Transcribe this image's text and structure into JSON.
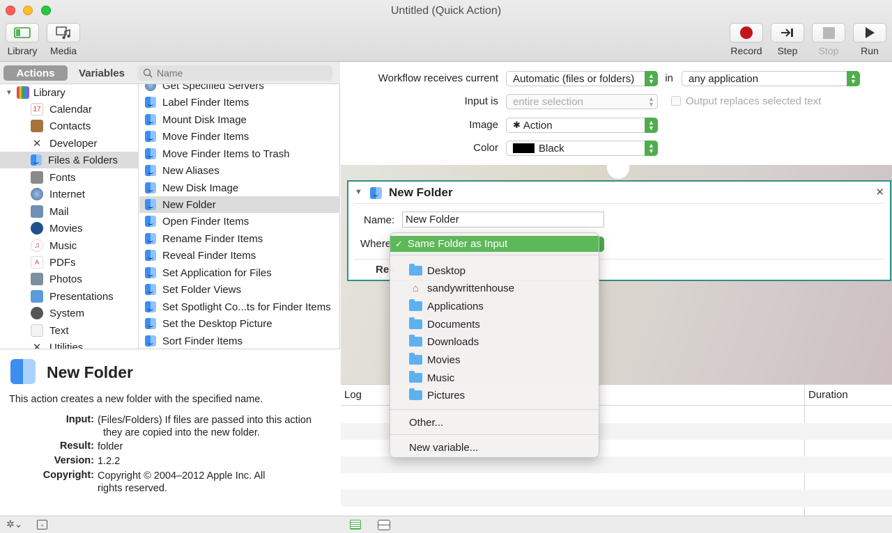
{
  "window": {
    "title": "Untitled (Quick Action)"
  },
  "toolbar": {
    "library": "Library",
    "media": "Media",
    "record": "Record",
    "step": "Step",
    "stop": "Stop",
    "run": "Run"
  },
  "tabs": {
    "actions": "Actions",
    "variables": "Variables"
  },
  "search": {
    "placeholder": "Name"
  },
  "library": {
    "root": "Library",
    "items": [
      {
        "label": "Calendar",
        "icon": "calendar-icon"
      },
      {
        "label": "Contacts",
        "icon": "contacts-icon"
      },
      {
        "label": "Developer",
        "icon": "developer-icon"
      },
      {
        "label": "Files & Folders",
        "icon": "finder-icon"
      },
      {
        "label": "Fonts",
        "icon": "fonts-icon"
      },
      {
        "label": "Internet",
        "icon": "globe-icon"
      },
      {
        "label": "Mail",
        "icon": "mail-icon"
      },
      {
        "label": "Movies",
        "icon": "quicktime-icon"
      },
      {
        "label": "Music",
        "icon": "music-icon"
      },
      {
        "label": "PDFs",
        "icon": "pdf-icon"
      },
      {
        "label": "Photos",
        "icon": "photos-icon"
      },
      {
        "label": "Presentations",
        "icon": "presentation-icon"
      },
      {
        "label": "System",
        "icon": "system-icon"
      },
      {
        "label": "Text",
        "icon": "text-icon"
      },
      {
        "label": "Utilities",
        "icon": "utilities-icon"
      }
    ]
  },
  "actions": [
    "Get Specified Servers",
    "Label Finder Items",
    "Mount Disk Image",
    "Move Finder Items",
    "Move Finder Items to Trash",
    "New Aliases",
    "New Disk Image",
    "New Folder",
    "Open Finder Items",
    "Rename Finder Items",
    "Reveal Finder Items",
    "Set Application for Files",
    "Set Folder Views",
    "Set Spotlight Co...ts for Finder Items",
    "Set the Desktop Picture",
    "Sort Finder Items"
  ],
  "description": {
    "title": "New Folder",
    "summary": "This action creates a new folder with the specified name.",
    "input_label": "Input:",
    "input_value_1": "(Files/Folders) If files are passed into this action",
    "input_value_2": "they are copied into the new folder.",
    "result_label": "Result:",
    "result_value": "folder",
    "version_label": "Version:",
    "version_value": "1.2.2",
    "copyright_label": "Copyright:",
    "copyright_value_1": "Copyright © 2004–2012 Apple Inc.  All",
    "copyright_value_2": "rights reserved."
  },
  "workflow": {
    "receives_label": "Workflow receives current",
    "receives_value": "Automatic (files or folders)",
    "in_label": "in",
    "app_value": "any application",
    "input_is_label": "Input is",
    "input_is_value": "entire selection",
    "output_replaces_label": "Output replaces selected text",
    "image_label": "Image",
    "image_value": "Action",
    "color_label": "Color",
    "color_value": "Black",
    "color_swatch": "#000000"
  },
  "action_block": {
    "title": "New Folder",
    "name_label": "Name:",
    "name_value": "New Folder",
    "where_label": "Where",
    "results_label": "Res"
  },
  "log": {
    "col_log": "Log",
    "col_duration": "Duration"
  },
  "menu": {
    "selected": "Same Folder as Input",
    "items": [
      {
        "label": "Desktop",
        "icon": "folder-desktop-icon"
      },
      {
        "label": "sandywrittenhouse",
        "icon": "home-icon"
      },
      {
        "label": "Applications",
        "icon": "folder-applications-icon"
      },
      {
        "label": "Documents",
        "icon": "folder-documents-icon"
      },
      {
        "label": "Downloads",
        "icon": "folder-downloads-icon"
      },
      {
        "label": "Movies",
        "icon": "folder-movies-icon"
      },
      {
        "label": "Music",
        "icon": "folder-music-icon"
      },
      {
        "label": "Pictures",
        "icon": "folder-pictures-icon"
      }
    ],
    "other": "Other...",
    "new_variable": "New variable..."
  },
  "colors": {
    "accent_green": "#4fae4c",
    "action_border": "#2f8f86",
    "selection_grey": "#dcdcdc"
  }
}
